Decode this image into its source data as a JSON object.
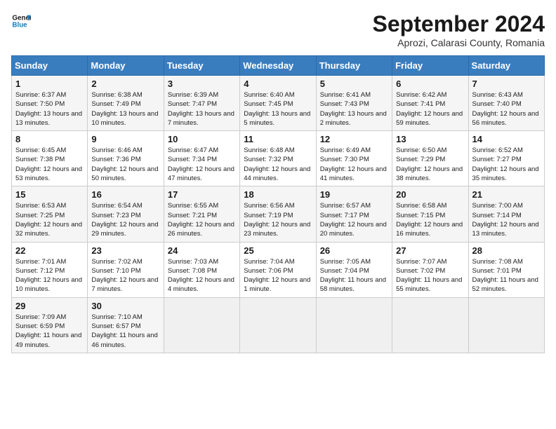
{
  "logo": {
    "line1": "General",
    "line2": "Blue"
  },
  "title": "September 2024",
  "subtitle": "Aprozi, Calarasi County, Romania",
  "days_header": [
    "Sunday",
    "Monday",
    "Tuesday",
    "Wednesday",
    "Thursday",
    "Friday",
    "Saturday"
  ],
  "weeks": [
    [
      {
        "day": "1",
        "sunrise": "6:37 AM",
        "sunset": "7:50 PM",
        "daylight": "13 hours and 13 minutes."
      },
      {
        "day": "2",
        "sunrise": "6:38 AM",
        "sunset": "7:49 PM",
        "daylight": "13 hours and 10 minutes."
      },
      {
        "day": "3",
        "sunrise": "6:39 AM",
        "sunset": "7:47 PM",
        "daylight": "13 hours and 7 minutes."
      },
      {
        "day": "4",
        "sunrise": "6:40 AM",
        "sunset": "7:45 PM",
        "daylight": "13 hours and 5 minutes."
      },
      {
        "day": "5",
        "sunrise": "6:41 AM",
        "sunset": "7:43 PM",
        "daylight": "13 hours and 2 minutes."
      },
      {
        "day": "6",
        "sunrise": "6:42 AM",
        "sunset": "7:41 PM",
        "daylight": "12 hours and 59 minutes."
      },
      {
        "day": "7",
        "sunrise": "6:43 AM",
        "sunset": "7:40 PM",
        "daylight": "12 hours and 56 minutes."
      }
    ],
    [
      {
        "day": "8",
        "sunrise": "6:45 AM",
        "sunset": "7:38 PM",
        "daylight": "12 hours and 53 minutes."
      },
      {
        "day": "9",
        "sunrise": "6:46 AM",
        "sunset": "7:36 PM",
        "daylight": "12 hours and 50 minutes."
      },
      {
        "day": "10",
        "sunrise": "6:47 AM",
        "sunset": "7:34 PM",
        "daylight": "12 hours and 47 minutes."
      },
      {
        "day": "11",
        "sunrise": "6:48 AM",
        "sunset": "7:32 PM",
        "daylight": "12 hours and 44 minutes."
      },
      {
        "day": "12",
        "sunrise": "6:49 AM",
        "sunset": "7:30 PM",
        "daylight": "12 hours and 41 minutes."
      },
      {
        "day": "13",
        "sunrise": "6:50 AM",
        "sunset": "7:29 PM",
        "daylight": "12 hours and 38 minutes."
      },
      {
        "day": "14",
        "sunrise": "6:52 AM",
        "sunset": "7:27 PM",
        "daylight": "12 hours and 35 minutes."
      }
    ],
    [
      {
        "day": "15",
        "sunrise": "6:53 AM",
        "sunset": "7:25 PM",
        "daylight": "12 hours and 32 minutes."
      },
      {
        "day": "16",
        "sunrise": "6:54 AM",
        "sunset": "7:23 PM",
        "daylight": "12 hours and 29 minutes."
      },
      {
        "day": "17",
        "sunrise": "6:55 AM",
        "sunset": "7:21 PM",
        "daylight": "12 hours and 26 minutes."
      },
      {
        "day": "18",
        "sunrise": "6:56 AM",
        "sunset": "7:19 PM",
        "daylight": "12 hours and 23 minutes."
      },
      {
        "day": "19",
        "sunrise": "6:57 AM",
        "sunset": "7:17 PM",
        "daylight": "12 hours and 20 minutes."
      },
      {
        "day": "20",
        "sunrise": "6:58 AM",
        "sunset": "7:15 PM",
        "daylight": "12 hours and 16 minutes."
      },
      {
        "day": "21",
        "sunrise": "7:00 AM",
        "sunset": "7:14 PM",
        "daylight": "12 hours and 13 minutes."
      }
    ],
    [
      {
        "day": "22",
        "sunrise": "7:01 AM",
        "sunset": "7:12 PM",
        "daylight": "12 hours and 10 minutes."
      },
      {
        "day": "23",
        "sunrise": "7:02 AM",
        "sunset": "7:10 PM",
        "daylight": "12 hours and 7 minutes."
      },
      {
        "day": "24",
        "sunrise": "7:03 AM",
        "sunset": "7:08 PM",
        "daylight": "12 hours and 4 minutes."
      },
      {
        "day": "25",
        "sunrise": "7:04 AM",
        "sunset": "7:06 PM",
        "daylight": "12 hours and 1 minute."
      },
      {
        "day": "26",
        "sunrise": "7:05 AM",
        "sunset": "7:04 PM",
        "daylight": "11 hours and 58 minutes."
      },
      {
        "day": "27",
        "sunrise": "7:07 AM",
        "sunset": "7:02 PM",
        "daylight": "11 hours and 55 minutes."
      },
      {
        "day": "28",
        "sunrise": "7:08 AM",
        "sunset": "7:01 PM",
        "daylight": "11 hours and 52 minutes."
      }
    ],
    [
      {
        "day": "29",
        "sunrise": "7:09 AM",
        "sunset": "6:59 PM",
        "daylight": "11 hours and 49 minutes."
      },
      {
        "day": "30",
        "sunrise": "7:10 AM",
        "sunset": "6:57 PM",
        "daylight": "11 hours and 46 minutes."
      },
      null,
      null,
      null,
      null,
      null
    ]
  ]
}
